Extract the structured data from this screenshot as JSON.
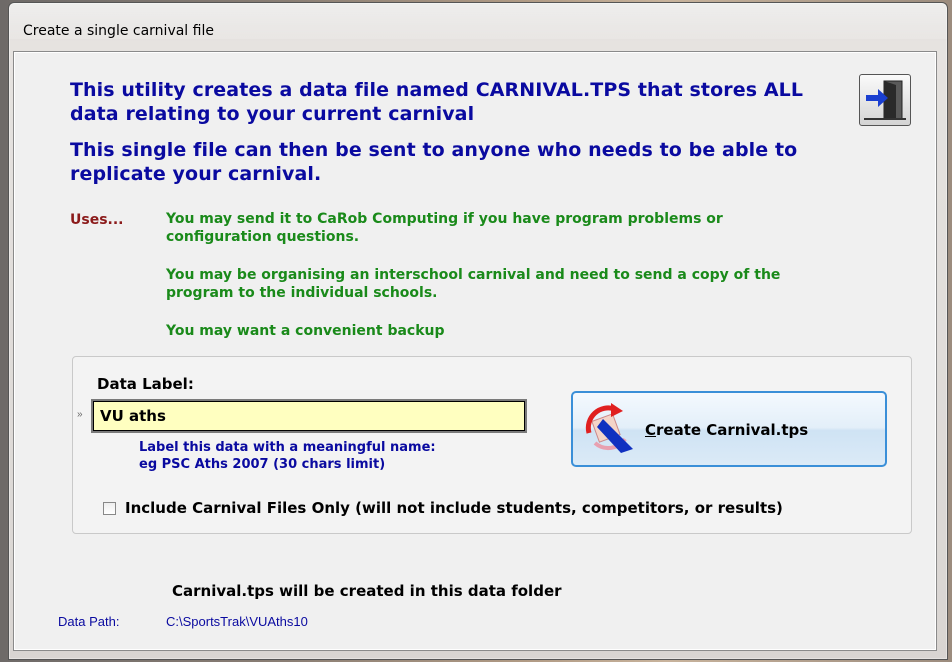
{
  "window": {
    "title": "Create a single carnival file"
  },
  "intro": {
    "line1": "This utility creates a data file named CARNIVAL.TPS that stores ALL data relating to your current carnival",
    "line2": "This single file can then be sent to anyone who needs to be able to replicate your carnival."
  },
  "uses": {
    "label": "Uses...",
    "items": [
      "You may send it to CaRob Computing if you have program problems or configuration questions.",
      "You may be organising an interschool carnival and need to send a copy of the program to the individual schools.",
      "You may want a convenient backup"
    ]
  },
  "form": {
    "data_label_caption": "Data Label:",
    "data_label_value": "VU aths",
    "hint_line1": "Label this data with a meaningful name:",
    "hint_line2": "eg PSC Aths 2007 (30 chars limit)",
    "create_button_rest": "reate Carnival.tps",
    "create_button_accel": "C",
    "checkbox_label": "Include Carnival Files Only (will not include students, competitors, or results)",
    "checkbox_checked": false
  },
  "footer": {
    "created_note": "Carnival.tps will be created in this data folder",
    "path_label": "Data Path:",
    "path_value": "C:\\SportsTrak\\VUAths10"
  },
  "icons": {
    "exit": "exit-door-icon",
    "create": "create-carnival-icon"
  },
  "colors": {
    "heading_blue": "#0a0aa0",
    "uses_red": "#8b1a1a",
    "uses_green": "#1a8a1a",
    "input_bg": "#ffffc0"
  }
}
